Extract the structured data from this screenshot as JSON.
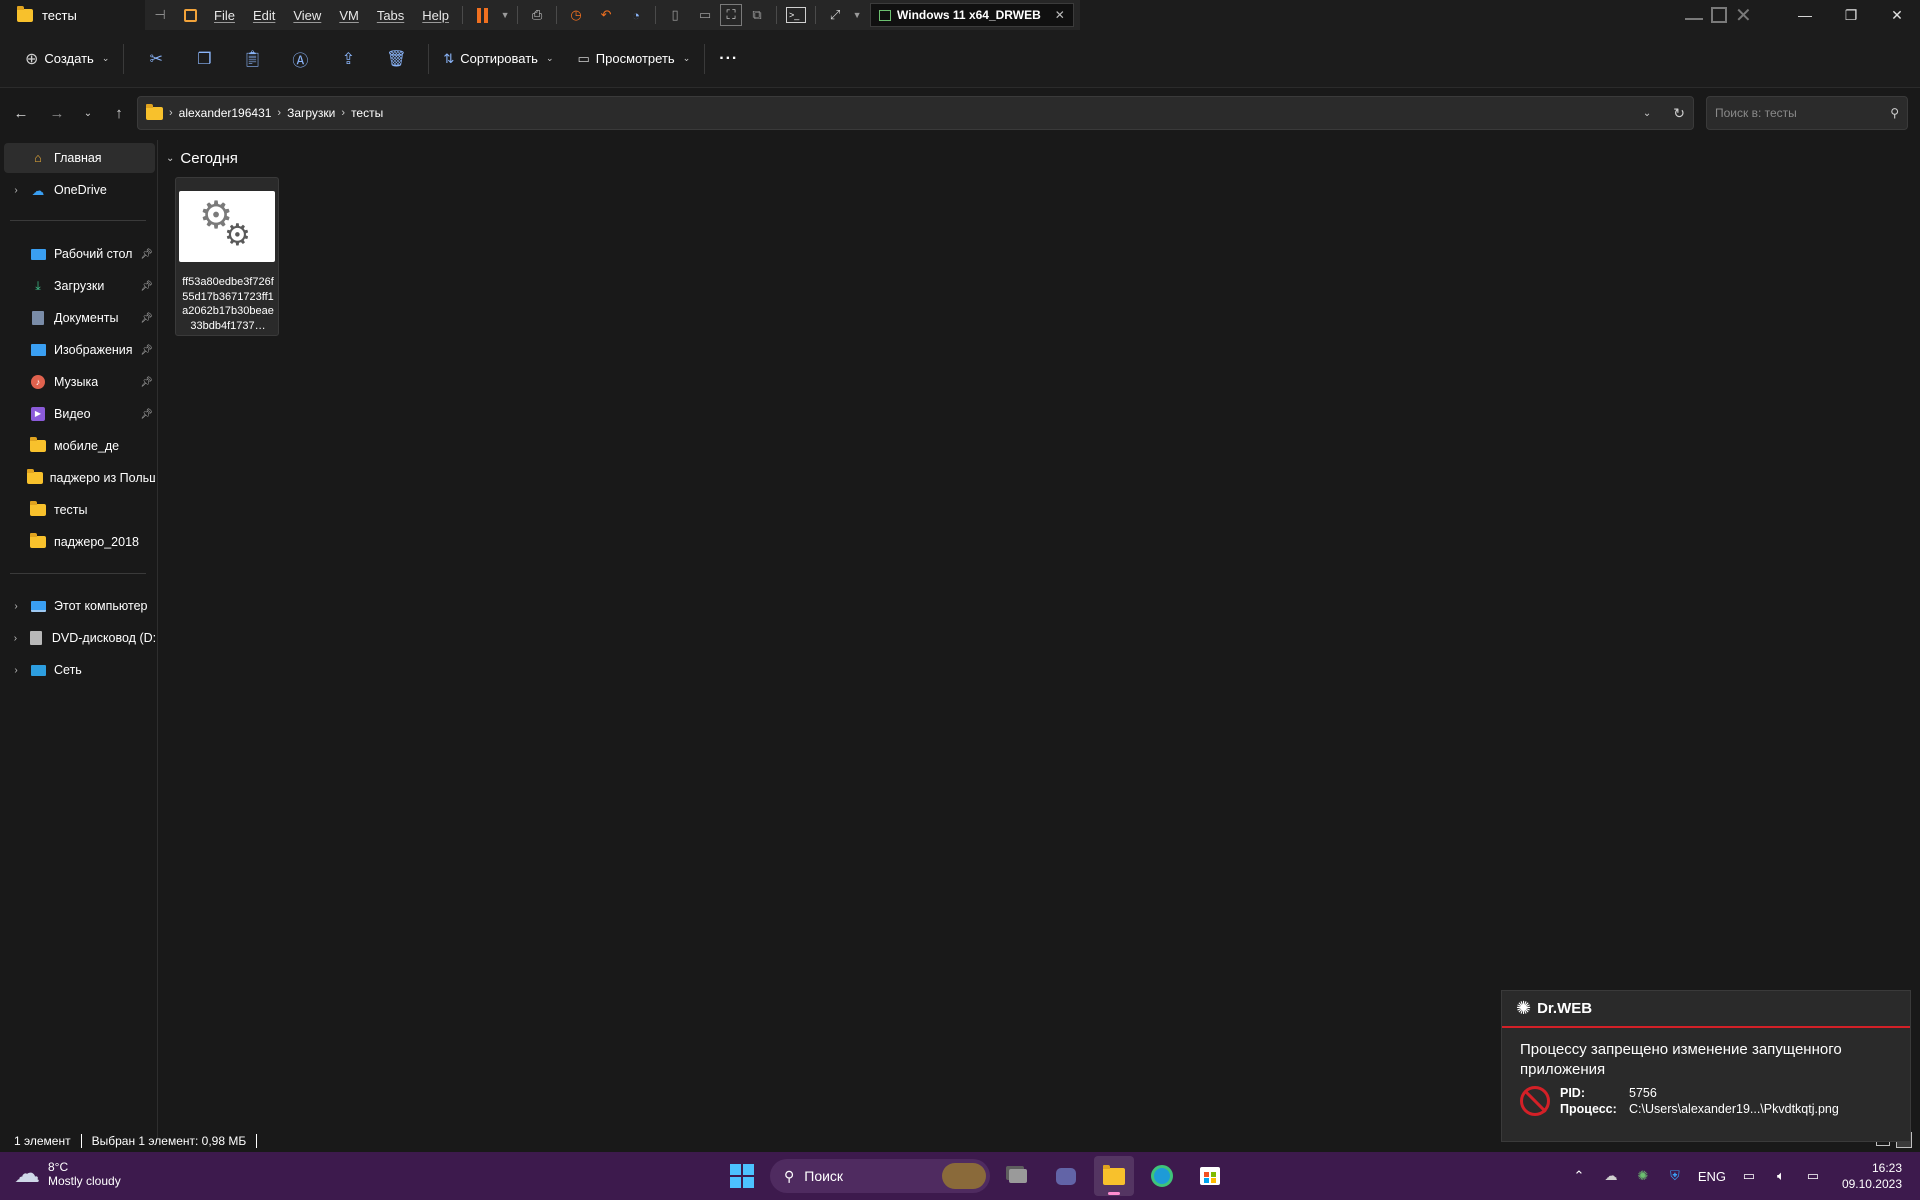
{
  "window": {
    "title": "тесты"
  },
  "vm_toolbar": {
    "menus": [
      "File",
      "Edit",
      "View",
      "VM",
      "Tabs",
      "Help"
    ],
    "tab_title": "Windows 11 x64_DRWEB",
    "tab_close": "✕"
  },
  "commands": {
    "new_label": "Создать",
    "sort_label": "Сортировать",
    "view_label": "Просмотреть",
    "more_label": "···"
  },
  "address": {
    "crumbs": [
      "alexander196431",
      "Загрузки",
      "тесты"
    ]
  },
  "search": {
    "placeholder": "Поиск в: тесты"
  },
  "sidebar": {
    "items": [
      {
        "label": "Главная",
        "icon": "home-icon"
      },
      {
        "label": "OneDrive",
        "icon": "cloud-icon"
      },
      {
        "label": "Рабочий стол",
        "icon": "desktop-icon"
      },
      {
        "label": "Загрузки",
        "icon": "download-icon"
      },
      {
        "label": "Документы",
        "icon": "document-icon"
      },
      {
        "label": "Изображения",
        "icon": "image-icon"
      },
      {
        "label": "Музыка",
        "icon": "music-icon"
      },
      {
        "label": "Видео",
        "icon": "video-icon"
      },
      {
        "label": "мобиле_де",
        "icon": "folder-icon"
      },
      {
        "label": "паджеро из Польши",
        "icon": "folder-icon"
      },
      {
        "label": "тесты",
        "icon": "folder-icon"
      },
      {
        "label": "паджеро_2018",
        "icon": "folder-icon"
      },
      {
        "label": "Этот компьютер",
        "icon": "computer-icon"
      },
      {
        "label": "DVD-дисковод (D:)",
        "icon": "dvd-icon"
      },
      {
        "label": "Сеть",
        "icon": "network-icon"
      }
    ]
  },
  "content": {
    "group_header": "Сегодня",
    "file_name": "ff53a80edbe3f726f55d17b3671723ff1a2062b17b30beae33bdb4f1737…"
  },
  "status": {
    "count": "1 элемент",
    "selected": "Выбран 1 элемент: 0,98 МБ"
  },
  "notification": {
    "brand": "Dr.WEB",
    "message": "Процессу запрещено изменение запущенного приложения",
    "pid_label": "PID:",
    "pid_value": "5756",
    "process_label": "Процесс:",
    "process_value": "C:\\Users\\alexander19...\\Pkvdtkqtj.png",
    "accent_color": "#d42027"
  },
  "taskbar": {
    "temperature": "8°C",
    "weather": "Mostly cloudy",
    "search_label": "Поиск",
    "language": "ENG",
    "time": "16:23",
    "date": "09.10.2023",
    "accent_color": "#3d1a4d"
  }
}
